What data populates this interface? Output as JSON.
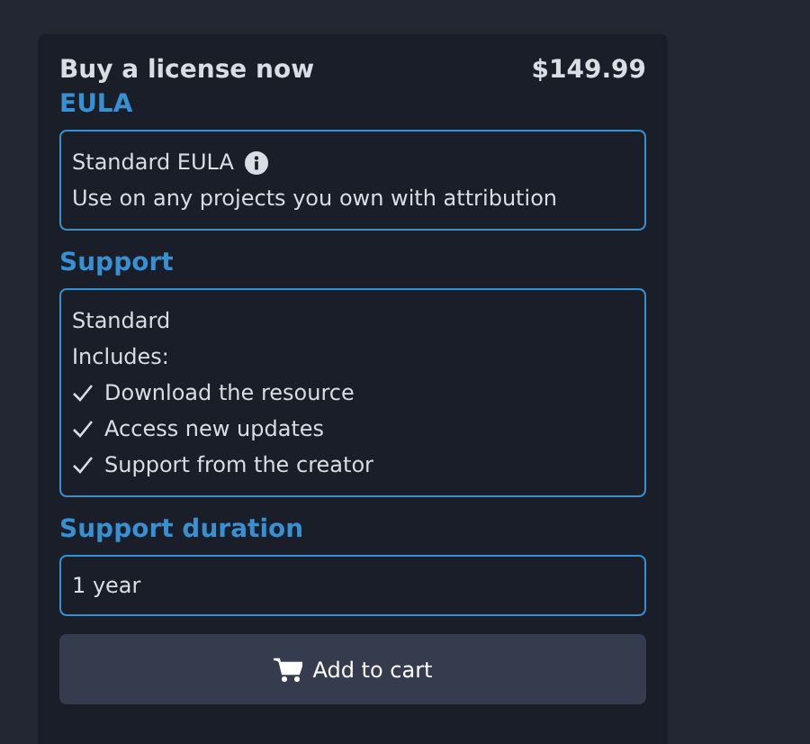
{
  "card": {
    "title": "Buy a license now",
    "price": "$149.99"
  },
  "eula": {
    "heading": "EULA",
    "name": "Standard EULA",
    "description": "Use on any projects you own with attribution"
  },
  "support": {
    "heading": "Support",
    "name": "Standard",
    "includes_label": "Includes:",
    "features": [
      "Download the resource",
      "Access new updates",
      "Support from the creator"
    ]
  },
  "duration": {
    "heading": "Support duration",
    "value": "1 year"
  },
  "button": {
    "label": "Add to cart"
  }
}
